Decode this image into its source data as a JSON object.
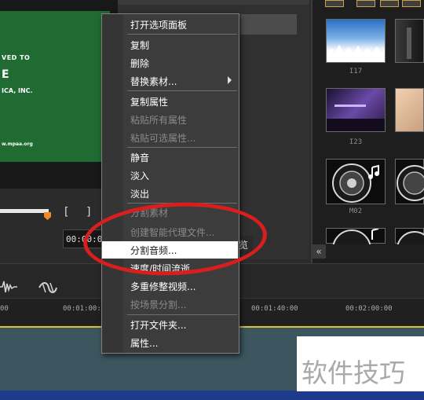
{
  "preview": {
    "line1": "VED TO",
    "line2": "E",
    "line3": "ICA, INC.",
    "line4": "w.mpaa.org",
    "bracket_left": "[",
    "bracket_right": "]",
    "timecode": "00:00:0"
  },
  "middle_panel": {
    "side_label": "览"
  },
  "context_menu": {
    "items": [
      {
        "label": "打开选项面板",
        "enabled": true
      },
      {
        "label": "复制",
        "enabled": true
      },
      {
        "label": "删除",
        "enabled": true
      },
      {
        "label": "替换素材...",
        "enabled": true,
        "submenu": true
      },
      {
        "label": "复制属性",
        "enabled": true
      },
      {
        "label": "粘贴所有属性",
        "enabled": false
      },
      {
        "label": "粘贴可选属性...",
        "enabled": false
      },
      {
        "label": "静音",
        "enabled": true
      },
      {
        "label": "淡入",
        "enabled": true
      },
      {
        "label": "淡出",
        "enabled": true
      },
      {
        "label": "分割素材",
        "enabled": false
      },
      {
        "label": "创建智能代理文件...",
        "enabled": false
      },
      {
        "label": "分割音频...",
        "enabled": true,
        "highlighted": true
      },
      {
        "label": "速度/时间流逝...",
        "enabled": true
      },
      {
        "label": "多重修整视频...",
        "enabled": true
      },
      {
        "label": "按场景分割...",
        "enabled": false
      },
      {
        "label": "打开文件夹...",
        "enabled": true
      },
      {
        "label": "属性...",
        "enabled": true
      }
    ]
  },
  "library": {
    "thumbnails": [
      {
        "label": "I17",
        "kind": "snowy-trees"
      },
      {
        "label": "",
        "kind": "dark-object"
      },
      {
        "label": "I23",
        "kind": "purple-room"
      },
      {
        "label": "",
        "kind": "peach-fabric"
      },
      {
        "label": "M02",
        "kind": "speaker"
      },
      {
        "label": "",
        "kind": "speaker"
      },
      {
        "label": "",
        "kind": "speaker"
      },
      {
        "label": "",
        "kind": "speaker"
      }
    ],
    "collapse_icon": "double-chevron-left-icon"
  },
  "timeline": {
    "ruler_labels": [
      "00",
      "00:01:00:0",
      "00:01:40:00",
      "00:02:00:00"
    ]
  },
  "watermark": {
    "text": "软件技巧"
  },
  "colors": {
    "menu_bg": "#3c3c3c",
    "highlight": "#ffffff",
    "annotation": "#d81e1e",
    "preview_green": "#1f6b32",
    "track": "#3c555e"
  }
}
